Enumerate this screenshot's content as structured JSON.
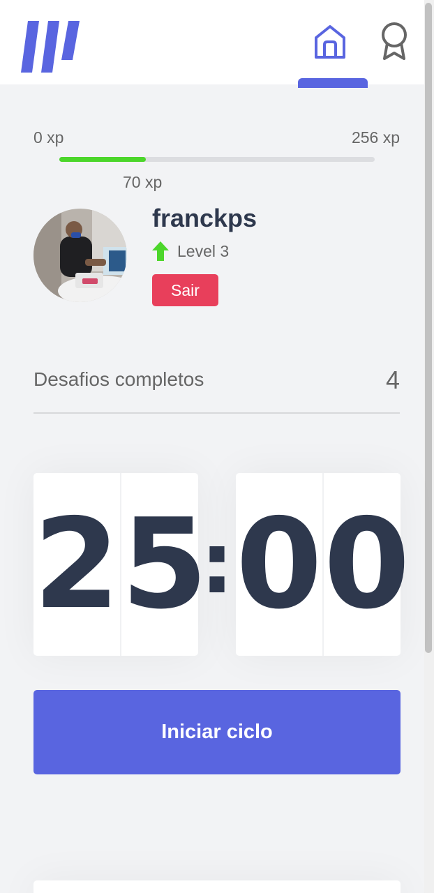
{
  "nav": {
    "logo_icon": "logo-stripes",
    "home_icon": "home-icon",
    "award_icon": "award-icon",
    "active": "home",
    "accent_color": "#5965e0"
  },
  "experience": {
    "min_label": "0 xp",
    "max_label": "256 xp",
    "current_label": "70 xp",
    "current": 70,
    "max": 256,
    "bar_color": "#4cd62b"
  },
  "profile": {
    "username": "franckps",
    "level_label": "Level 3",
    "level_icon": "level-up-arrow-icon",
    "logout_label": "Sair",
    "logout_color": "#e83f5b"
  },
  "completed_challenges": {
    "label": "Desafios completos",
    "count": "4"
  },
  "countdown": {
    "minute_left": "2",
    "minute_right": "5",
    "separator": ":",
    "second_left": "0",
    "second_right": "0"
  },
  "start_button": {
    "label": "Iniciar ciclo",
    "color": "#5965e0"
  }
}
